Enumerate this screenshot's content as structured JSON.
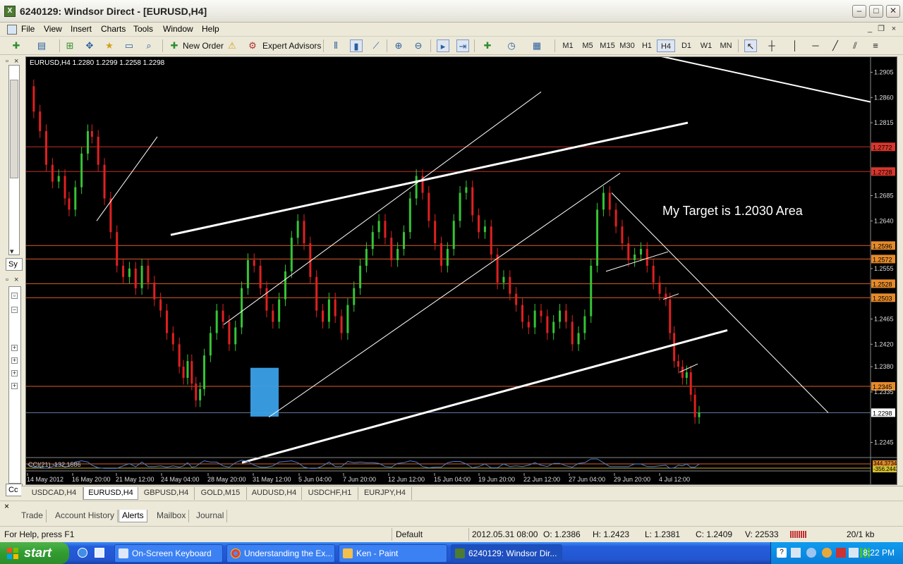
{
  "window": {
    "title": "6240129: Windsor Direct - [EURUSD,H4]",
    "min": "–",
    "max": "□",
    "close": "✕"
  },
  "menu": {
    "items": [
      "File",
      "View",
      "Insert",
      "Charts",
      "Tools",
      "Window",
      "Help"
    ]
  },
  "toolbar": {
    "new_order": "New Order",
    "expert_advisors": "Expert Advisors",
    "timeframes": [
      "M1",
      "M5",
      "M15",
      "M30",
      "H1",
      "H4",
      "D1",
      "W1",
      "MN"
    ],
    "active_timeframe": "H4"
  },
  "left": {
    "sy_label": "Sy",
    "cc_label": "Cc"
  },
  "chart_data": {
    "type": "candlestick",
    "symbol_info": "EURUSD,H4  1.2280 1.2299 1.2258 1.2298",
    "annotation": "My Target is 1.2030 Area",
    "price_ticks": [
      "1.2905",
      "1.2860",
      "1.2815",
      "1.2685",
      "1.2640",
      "1.2555",
      "1.2465",
      "1.2420",
      "1.2380",
      "1.2335",
      "1.2245"
    ],
    "tick_values": [
      1.2905,
      1.286,
      1.2815,
      1.2685,
      1.264,
      1.2555,
      1.2465,
      1.242,
      1.238,
      1.2335,
      1.2245
    ],
    "ylim": [
      1.2218,
      1.2932
    ],
    "level_labels": [
      {
        "value": 1.2772,
        "label": "1.2772"
      },
      {
        "value": 1.2728,
        "label": "1.2728"
      },
      {
        "value": 1.2596,
        "label": "1.2596"
      },
      {
        "value": 1.2572,
        "label": "1.2572"
      },
      {
        "value": 1.2528,
        "label": "1.2528"
      },
      {
        "value": 1.2503,
        "label": "1.2503"
      },
      {
        "value": 1.2345,
        "label": "1.2345"
      }
    ],
    "current_price": {
      "value": 1.2298,
      "label": "1.2298"
    },
    "time_labels": [
      "14 May 2012",
      "16 May 20:00",
      "21 May 12:00",
      "24 May 04:00",
      "28 May 20:00",
      "31 May 12:00",
      "5 Jun 04:00",
      "7 Jun 20:00",
      "12 Jun 12:00",
      "15 Jun 04:00",
      "19 Jun 20:00",
      "22 Jun 12:00",
      "27 Jun 04:00",
      "29 Jun 20:00",
      "4 Jul 12:00"
    ],
    "indicator": {
      "label": "CCI(21) -132.1586",
      "value_label": "344.3734",
      "value_label2": "-356.2443"
    },
    "close_path": [
      [
        0,
        1.288
      ],
      [
        6,
        1.2835
      ],
      [
        12,
        1.28
      ],
      [
        18,
        1.274
      ],
      [
        24,
        1.271
      ],
      [
        30,
        1.272
      ],
      [
        36,
        1.268
      ],
      [
        40,
        1.266
      ],
      [
        46,
        1.27
      ],
      [
        52,
        1.276
      ],
      [
        58,
        1.28
      ],
      [
        62,
        1.279
      ],
      [
        68,
        1.274
      ],
      [
        74,
        1.268
      ],
      [
        80,
        1.262
      ],
      [
        86,
        1.256
      ],
      [
        92,
        1.254
      ],
      [
        98,
        1.2555
      ],
      [
        104,
        1.252
      ],
      [
        110,
        1.256
      ],
      [
        116,
        1.253
      ],
      [
        122,
        1.25
      ],
      [
        128,
        1.248
      ],
      [
        134,
        1.244
      ],
      [
        140,
        1.242
      ],
      [
        146,
        1.238
      ],
      [
        150,
        1.236
      ],
      [
        154,
        1.239
      ],
      [
        158,
        1.235
      ],
      [
        162,
        1.232
      ],
      [
        166,
        1.234
      ],
      [
        170,
        1.24
      ],
      [
        176,
        1.244
      ],
      [
        182,
        1.248
      ],
      [
        188,
        1.246
      ],
      [
        194,
        1.242
      ],
      [
        200,
        1.245
      ],
      [
        206,
        1.252
      ],
      [
        212,
        1.257
      ],
      [
        218,
        1.256
      ],
      [
        224,
        1.252
      ],
      [
        230,
        1.248
      ],
      [
        236,
        1.246
      ],
      [
        242,
        1.25
      ],
      [
        248,
        1.255
      ],
      [
        254,
        1.261
      ],
      [
        260,
        1.264
      ],
      [
        266,
        1.26
      ],
      [
        272,
        1.254
      ],
      [
        278,
        1.248
      ],
      [
        284,
        1.246
      ],
      [
        290,
        1.25
      ],
      [
        296,
        1.247
      ],
      [
        302,
        1.244
      ],
      [
        308,
        1.249
      ],
      [
        314,
        1.252
      ],
      [
        320,
        1.256
      ],
      [
        326,
        1.259
      ],
      [
        332,
        1.262
      ],
      [
        338,
        1.264
      ],
      [
        344,
        1.261
      ],
      [
        350,
        1.257
      ],
      [
        356,
        1.259
      ],
      [
        362,
        1.262
      ],
      [
        368,
        1.268
      ],
      [
        374,
        1.272
      ],
      [
        380,
        1.269
      ],
      [
        386,
        1.264
      ],
      [
        392,
        1.26
      ],
      [
        398,
        1.256
      ],
      [
        404,
        1.259
      ],
      [
        410,
        1.264
      ],
      [
        416,
        1.269
      ],
      [
        422,
        1.27
      ],
      [
        428,
        1.265
      ],
      [
        434,
        1.262
      ],
      [
        440,
        1.263
      ],
      [
        446,
        1.258
      ],
      [
        452,
        1.253
      ],
      [
        458,
        1.254
      ],
      [
        464,
        1.251
      ],
      [
        470,
        1.249
      ],
      [
        476,
        1.246
      ],
      [
        482,
        1.245
      ],
      [
        488,
        1.248
      ],
      [
        494,
        1.247
      ],
      [
        500,
        1.244
      ],
      [
        506,
        1.246
      ],
      [
        512,
        1.248
      ],
      [
        518,
        1.246
      ],
      [
        524,
        1.242
      ],
      [
        530,
        1.244
      ],
      [
        536,
        1.247
      ],
      [
        542,
        1.256
      ],
      [
        548,
        1.266
      ],
      [
        554,
        1.269
      ],
      [
        560,
        1.266
      ],
      [
        566,
        1.263
      ],
      [
        572,
        1.26
      ],
      [
        578,
        1.257
      ],
      [
        584,
        1.258
      ],
      [
        590,
        1.259
      ],
      [
        596,
        1.256
      ],
      [
        602,
        1.253
      ],
      [
        608,
        1.251
      ],
      [
        614,
        1.25
      ],
      [
        618,
        1.244
      ],
      [
        622,
        1.239
      ],
      [
        626,
        1.238
      ],
      [
        630,
        1.236
      ],
      [
        634,
        1.237
      ],
      [
        638,
        1.233
      ],
      [
        642,
        1.229
      ],
      [
        646,
        1.2298
      ]
    ]
  },
  "chart_tabs": [
    "USDCAD,H4",
    "EURUSD,H4",
    "GBPUSD,H4",
    "GOLD,M15",
    "AUDUSD,H4",
    "USDCHF,H1",
    "EURJPY,H4"
  ],
  "active_chart_tab": "EURUSD,H4",
  "terminal_tabs": [
    "Trade",
    "Account History",
    "Alerts",
    "Mailbox",
    "Journal"
  ],
  "active_terminal_tab": "Alerts",
  "terminal_close": "×",
  "status": {
    "help": "For Help, press F1",
    "profile": "Default",
    "datetime": "2012.05.31 08:00",
    "open": "O: 1.2386",
    "high": "H: 1.2423",
    "low": "L: 1.2381",
    "close": "C: 1.2409",
    "volume": "V: 22533",
    "traffic": "20/1 kb"
  },
  "taskbar": {
    "start": "start",
    "tasks": [
      "On-Screen Keyboard",
      "Understanding the Ex...",
      "Ken - Paint",
      "6240129: Windsor Dir..."
    ],
    "clock": "8:22 PM"
  }
}
